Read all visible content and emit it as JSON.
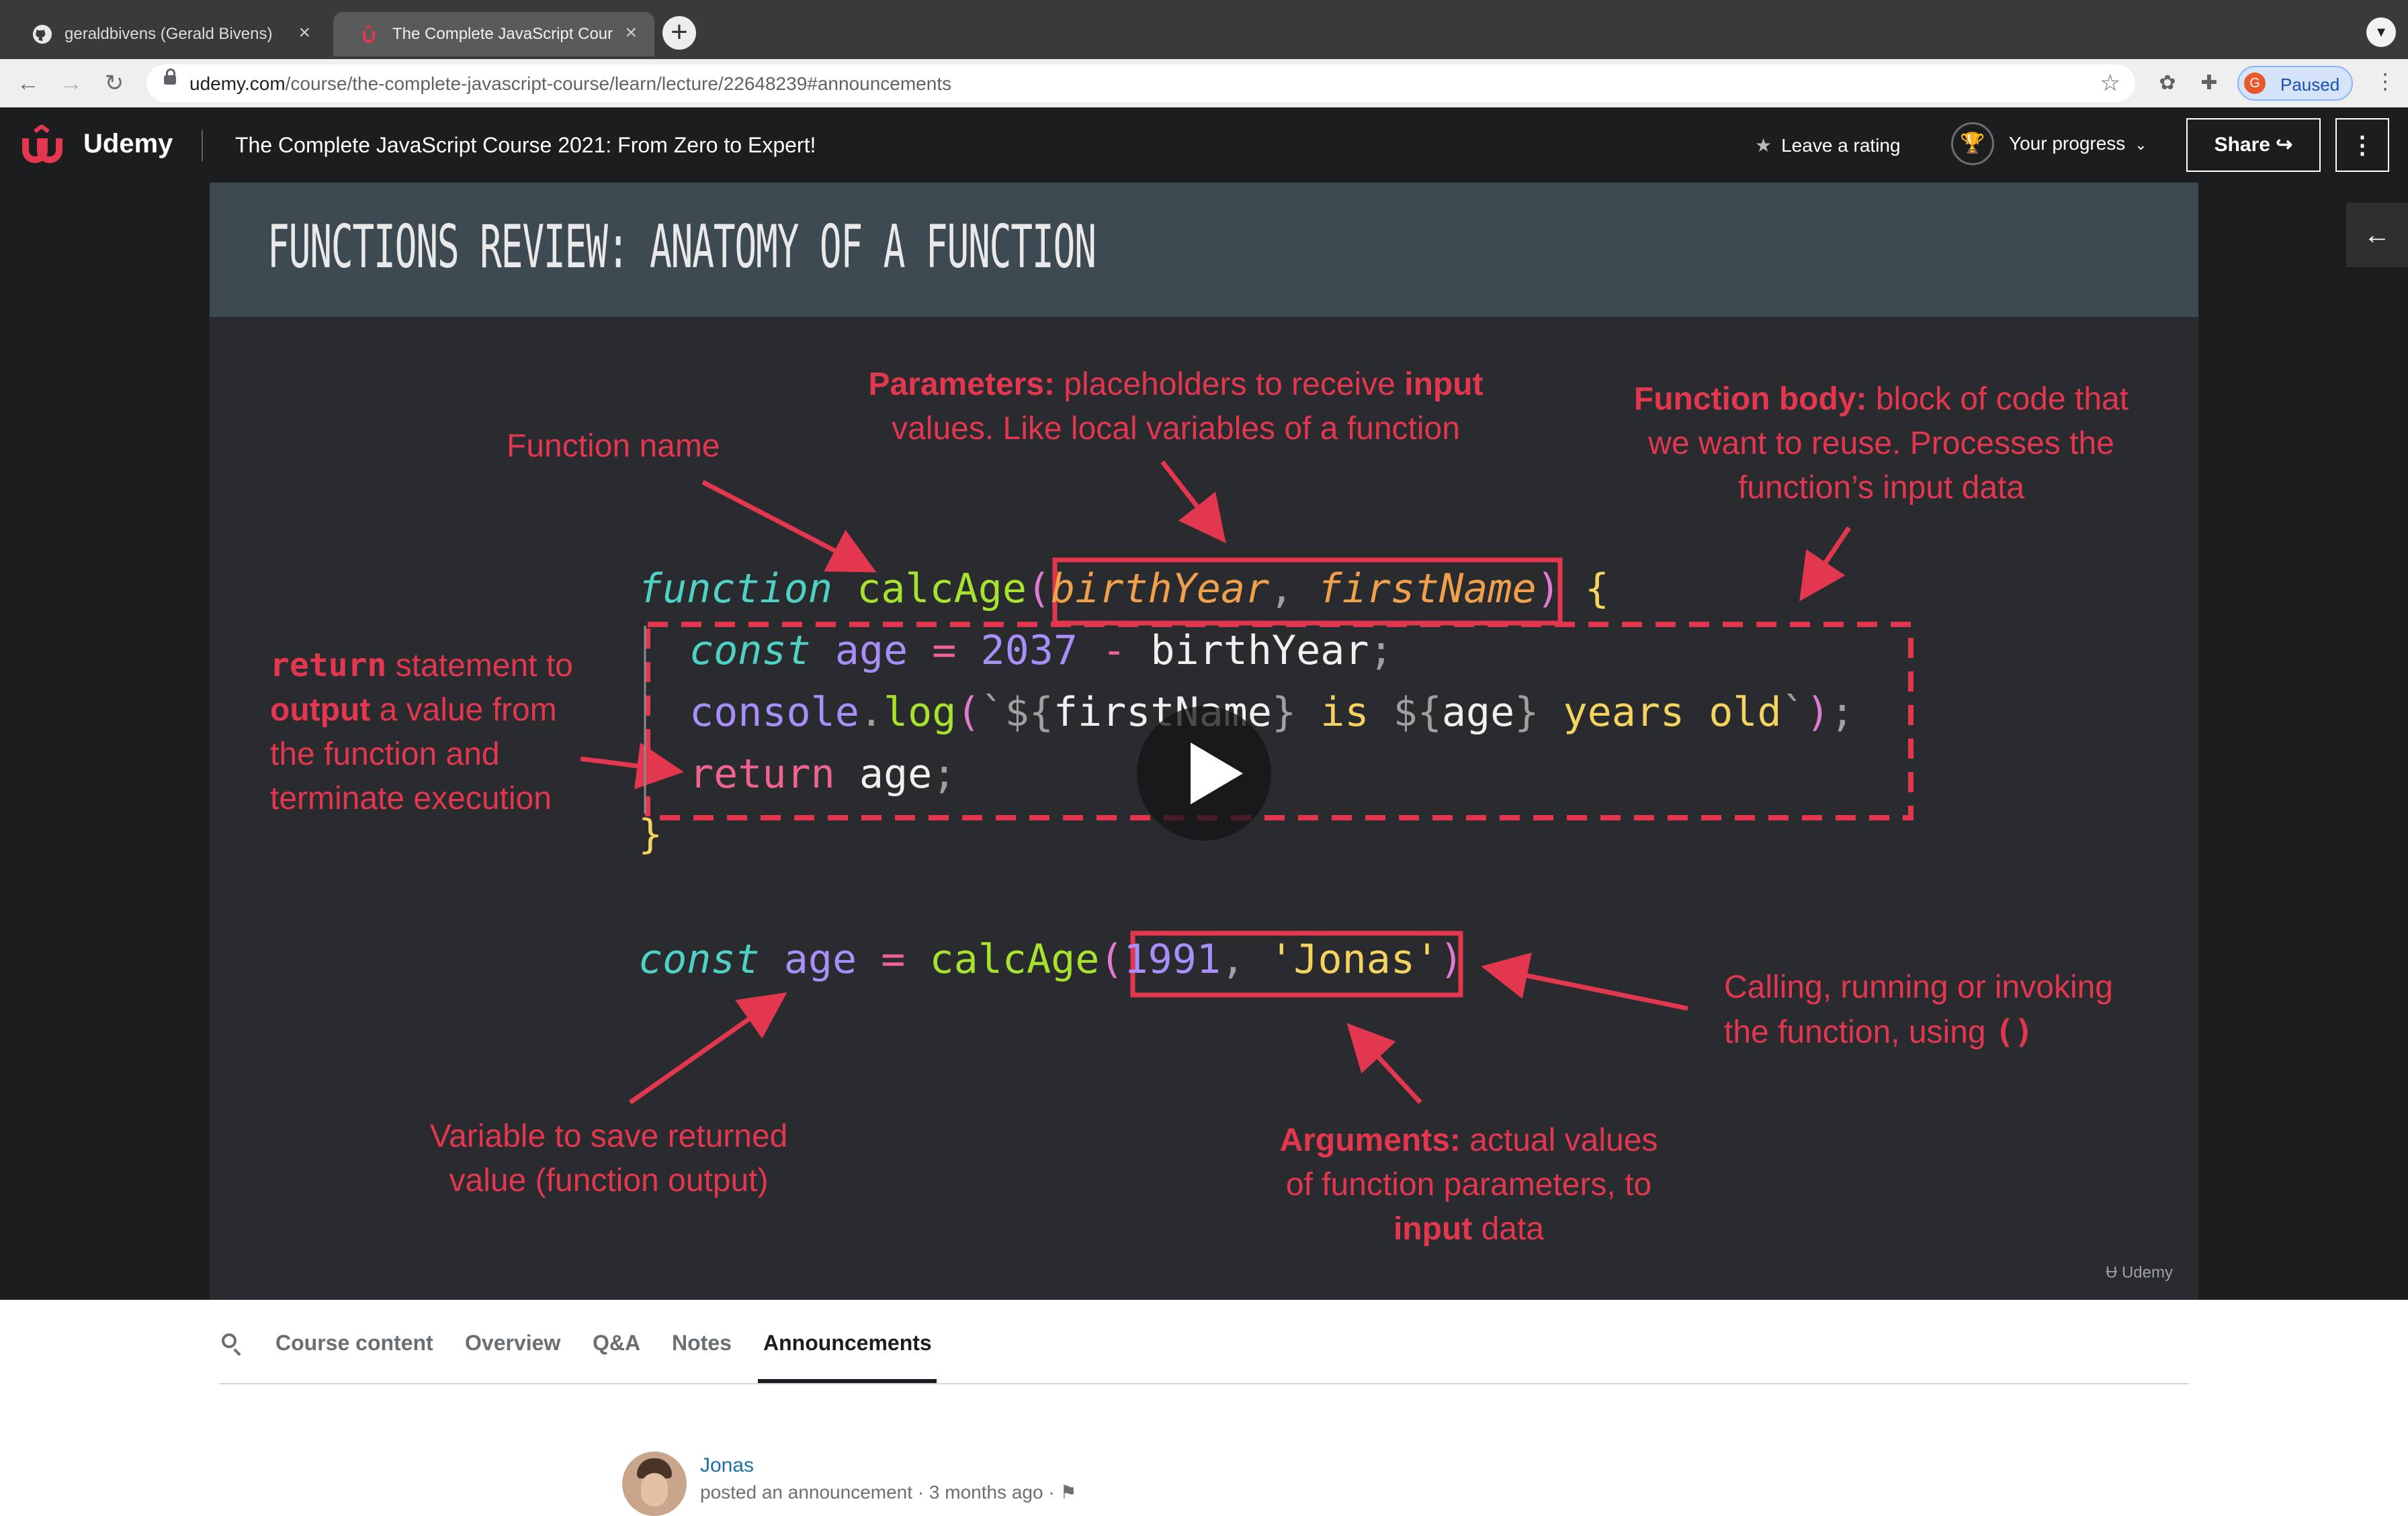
{
  "browser": {
    "tabs": [
      {
        "title": "geraldbivens (Gerald Bivens)",
        "close": "×",
        "icon": "github-icon"
      },
      {
        "title": "The Complete JavaScript Cour",
        "close": "×",
        "icon": "udemy-favicon-icon"
      }
    ],
    "new_tab": "+",
    "url_host": "udemy.com",
    "url_path": "/course/the-complete-javascript-course/learn/lecture/22648239#announcements",
    "profile_initial": "G",
    "profile_status": "Paused"
  },
  "header": {
    "logo_text": "Udemy",
    "course_title": "The Complete JavaScript Course 2021: From Zero to Expert!",
    "rating_label": "Leave a rating",
    "progress_label": "Your progress",
    "share_label": "Share"
  },
  "slide": {
    "title": "FUNCTIONS REVIEW: ANATOMY OF A FUNCTION",
    "annotations": {
      "function_name": "Function name",
      "params_bold": "Parameters:",
      "params_rest1": " placeholders to receive ",
      "params_bold2": "input",
      "params_line2": "values. Like local variables of a function",
      "body_bold": "Function body:",
      "body_rest1": " block of code that",
      "body_line2": "we want to reuse. Processes the",
      "body_line3": "function’s input data",
      "return_code": "return",
      "return_rest1": " statement to",
      "return_bold": "output",
      "return_rest2": " a value from",
      "return_line3": "the function and",
      "return_line4": "terminate execution",
      "calling_line1": "Calling, running or invoking",
      "calling_line2": "the function, using ",
      "calling_parens": "()",
      "variable_line1": "Variable to save returned",
      "variable_line2": "value (function output)",
      "args_bold": "Arguments:",
      "args_rest1": " actual values",
      "args_line2": "of function parameters, to",
      "args_bold2": "input",
      "args_rest3": " data"
    },
    "code": {
      "l1_kw": "function",
      "l1_fn": "calcAge",
      "l1_p1": "birthYear",
      "l1_p2": "firstName",
      "l2_kw": "const",
      "l2_var": "age",
      "l2_num": "2037",
      "l2_id": "birthYear",
      "l3_obj": "console",
      "l3_fn": "log",
      "l3_v1": "firstName",
      "l3_mid": " is ",
      "l3_v2": "age",
      "l3_end": " years old",
      "l4_kw": "return",
      "l4_id": "age",
      "l6_kw": "const",
      "l6_var": "age",
      "l6_fn": "calcAge",
      "l6_num": "1991",
      "l6_str": "'Jonas'"
    },
    "watermark": "Udemy"
  },
  "course_tabs": [
    "Course content",
    "Overview",
    "Q&A",
    "Notes",
    "Announcements"
  ],
  "announcement": {
    "author": "Jonas",
    "meta": "posted an announcement · 3 months ago · "
  }
}
